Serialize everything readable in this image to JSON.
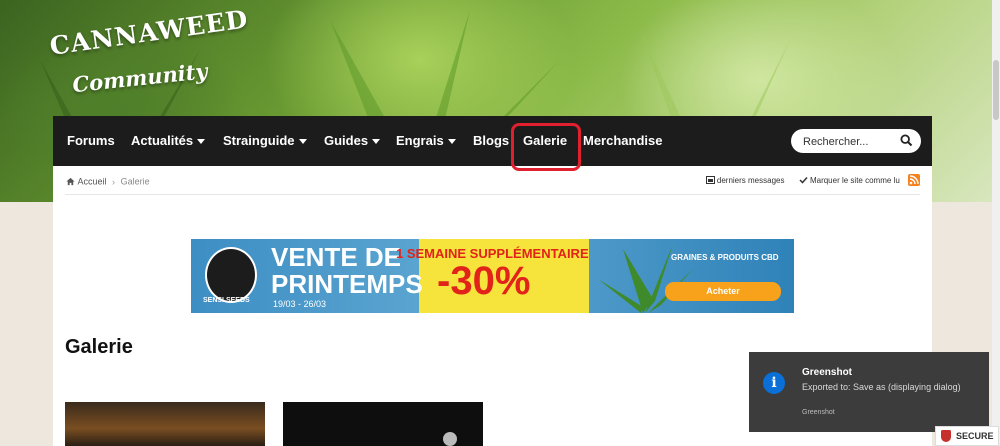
{
  "logo": {
    "line1": "CANNAWEED",
    "line2": "Community"
  },
  "nav": {
    "items": [
      {
        "label": "Forums",
        "caret": false
      },
      {
        "label": "Actualités",
        "caret": true
      },
      {
        "label": "Strainguide",
        "caret": true
      },
      {
        "label": "Guides",
        "caret": true
      },
      {
        "label": "Engrais",
        "caret": true
      },
      {
        "label": "Blogs",
        "caret": false
      },
      {
        "label": "Galerie",
        "caret": false
      },
      {
        "label": "Merchandise",
        "caret": false
      }
    ],
    "search_placeholder": "Rechercher..."
  },
  "breadcrumb": {
    "home": "Accueil",
    "current": "Galerie"
  },
  "toolbar": {
    "recent": "derniers messages",
    "mark_read": "Marquer le site comme lu"
  },
  "banner": {
    "brand": "SENSI SEEDS",
    "headline_1": "VENTE DE",
    "headline_2": "PRINTEMPS",
    "dates": "19/03 - 26/03",
    "subheadline": "1 SEMAINE SUPPLÉMENTAIRE",
    "discount": "-30%",
    "tagline": "GRAINES & PRODUITS CBD",
    "cta": "Acheter"
  },
  "page_title": "Galerie",
  "notification": {
    "title": "Greenshot",
    "message": "Exported to: Save as (displaying dialog)",
    "app": "Greenshot"
  },
  "secure_badge": "SECURE",
  "colors": {
    "nav_bg": "#1c1c1c",
    "highlight": "#e0202e",
    "rss": "#f5821f",
    "toast_bg": "#3c3c3c"
  }
}
